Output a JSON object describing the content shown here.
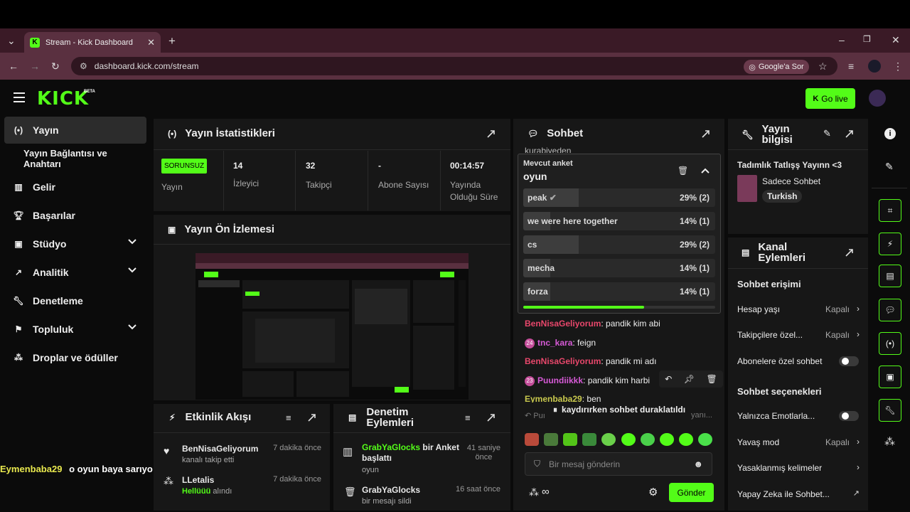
{
  "browser": {
    "tab_title": "Stream - Kick Dashboard",
    "tab_favicon": "K",
    "url": "dashboard.kick.com/stream",
    "google_chip": "Google'a Sor"
  },
  "header": {
    "logo": "KICK",
    "beta": "BETA",
    "go_live": "Go live"
  },
  "sidebar": {
    "items": [
      {
        "label": "Yayın",
        "icon": "broadcast-icon"
      },
      {
        "label": "Yayın Bağlantısı ve Anahtarı",
        "icon": ""
      },
      {
        "label": "Gelir",
        "icon": "chart-icon"
      },
      {
        "label": "Başarılar",
        "icon": "trophy-icon"
      },
      {
        "label": "Stüdyo",
        "icon": "studio-icon"
      },
      {
        "label": "Analitik",
        "icon": "analytics-icon"
      },
      {
        "label": "Denetleme",
        "icon": "wrench-icon"
      },
      {
        "label": "Topluluk",
        "icon": "community-icon"
      },
      {
        "label": "Droplar ve ödüller",
        "icon": "drops-icon"
      }
    ]
  },
  "overlay_chat": {
    "user": "Eymenbaba29",
    "message": "o oyun baya sarıyo"
  },
  "stats": {
    "title": "Yayın İstatistikleri",
    "status_badge": "SORUNSUZ",
    "status_label": "Yayın",
    "viewers": "14",
    "viewers_label": "İzleyici",
    "followers": "32",
    "followers_label": "Takipçi",
    "subs": "-",
    "subs_label": "Abone Sayısı",
    "uptime": "00:14:57",
    "uptime_label_1": "Yayında",
    "uptime_label_2": "Olduğu Süre"
  },
  "preview": {
    "title": "Yayın Ön İzlemesi"
  },
  "activity": {
    "title": "Etkinlik Akışı",
    "items": [
      {
        "name": "BenNisaGeliyorum",
        "sub": "kanalı takip etti",
        "time": "7 dakika önce",
        "icon": "heart-icon"
      },
      {
        "name": "LLetalis",
        "sub_highlight": "Hellüüü",
        "sub": "alındı",
        "time": "7 dakika önce",
        "icon": "drops-icon"
      }
    ]
  },
  "modactions": {
    "title_1": "Denetim",
    "title_2": "Eylemleri",
    "items": [
      {
        "user": "GrabYaGlocks",
        "text_1": "bir Anket",
        "text_2": "başlattı",
        "sub": "oyun",
        "time_1": "41 saniye",
        "time_2": "önce"
      },
      {
        "user": "GrabYaGlocks",
        "sub": "bir mesajı sildi",
        "time": "16 saat önce"
      }
    ]
  },
  "chat": {
    "title": "Sohbet",
    "top_cut": "kurabiyeden",
    "poll": {
      "label": "Mevcut anket",
      "question": "oyun",
      "options": [
        {
          "label": "peak",
          "pct": "29% (2)",
          "fraction": 0.29,
          "winner": true
        },
        {
          "label": "we were here together",
          "pct": "14% (1)",
          "fraction": 0.14
        },
        {
          "label": "cs",
          "pct": "29% (2)",
          "fraction": 0.29
        },
        {
          "label": "mecha",
          "pct": "14% (1)",
          "fraction": 0.14
        },
        {
          "label": "forza",
          "pct": "14% (1)",
          "fraction": 0.14
        }
      ],
      "time_progress": 0.63
    },
    "messages": [
      {
        "user": "BenNisaGeliyorum",
        "text": "pandik kim abi",
        "color": "#e8476b",
        "badge": ""
      },
      {
        "user": "tnc_kara",
        "text": "feign",
        "color": "#d65ad6",
        "badge": "24"
      },
      {
        "user": "BenNisaGeliyorum",
        "text": "pandik mi adı",
        "color": "#e8476b",
        "badge": ""
      },
      {
        "user": "Puundiikkk",
        "text": "pandik kim harbi",
        "color": "#d65ad6",
        "badge": "23"
      },
      {
        "user": "Eymenbaba29",
        "text": "ben",
        "color": "#c9c94e",
        "badge": ""
      }
    ],
    "paused_text": "kaydırırken sohbet duraklatıldı",
    "reply_cut_left": "Puı",
    "reply_cut_right": "yanı...",
    "input_placeholder": "Bir mesaj gönderin",
    "send": "Gönder"
  },
  "stream_info": {
    "title_1": "Yayın",
    "title_2": "bilgisi",
    "stream_title": "Tadımlık Tatlışş Yayınn <3",
    "category": "Sadece Sohbet",
    "language_tag": "Turkish"
  },
  "channel_actions": {
    "title_1": "Kanal",
    "title_2": "Eylemleri",
    "chat_access": "Sohbet erişimi",
    "account_age": "Hesap yaşı",
    "account_age_val": "Kapalı",
    "followers_only": "Takipçilere özel...",
    "followers_only_val": "Kapalı",
    "subs_only": "Abonelere özel sohbet",
    "chat_options": "Sohbet seçenekleri",
    "emotes_only": "Yalnızca Emotlarla...",
    "slow_mode": "Yavaş mod",
    "slow_mode_val": "Kapalı",
    "banned_words": "Yasaklanmış kelimeler",
    "ai": "Yapay Zeka ile Sohbet..."
  },
  "colors": {
    "accent": "#53fc18",
    "panel": "#171717",
    "background": "#0b0b0b"
  }
}
